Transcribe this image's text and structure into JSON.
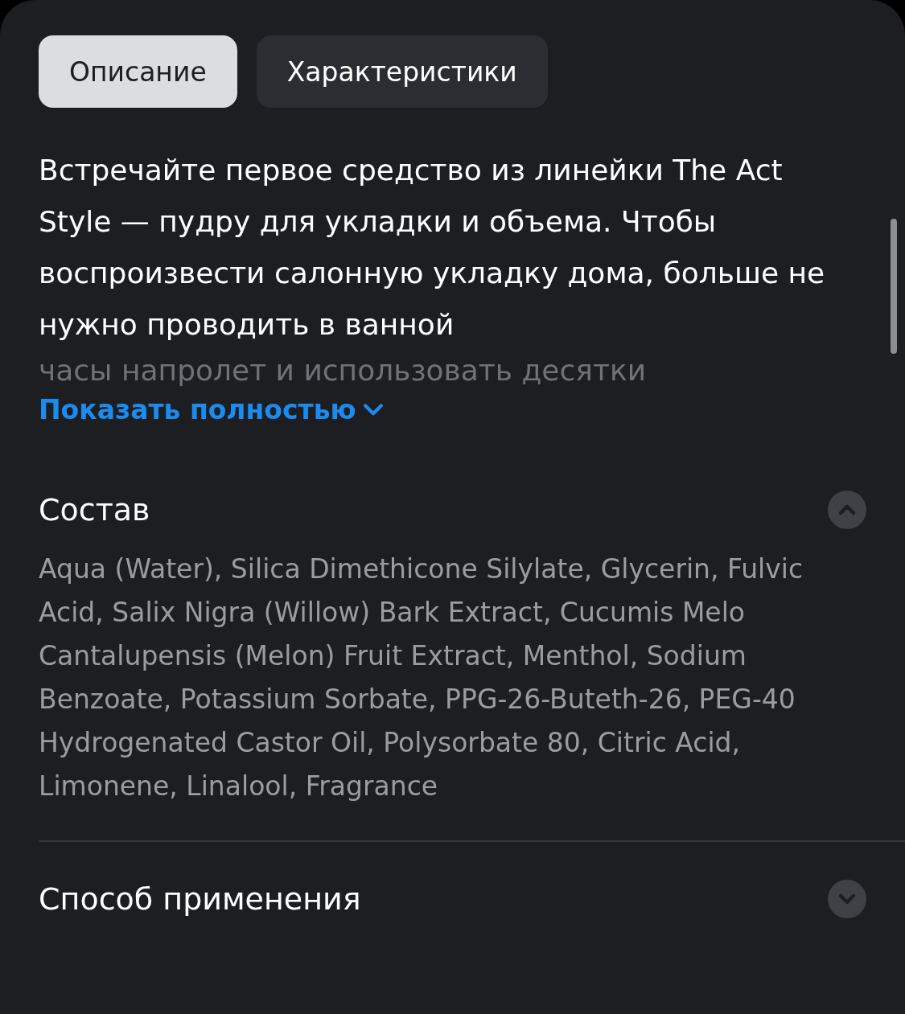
{
  "tabs": [
    {
      "label": "Описание",
      "selected": true
    },
    {
      "label": "Характеристики",
      "selected": false
    }
  ],
  "description": {
    "text": "Встречайте первое средство из линейки The Act Style — пудру для укладки и объема. Чтобы воспроизвести салонную укладку дома, больше не нужно проводить в ванной",
    "faded_text": "часы напролет и использовать десятки",
    "show_more": "Показать полностью"
  },
  "sections": [
    {
      "title": "Состав",
      "expanded": true,
      "text": "Aqua (Water), Silica Dimethicone Silylate, Glycerin, Fulvic Acid, Salix Nigra (Willow) Bark Extract, Cucumis Melo Cantalupensis (Melon) Fruit Extract, Menthol, Sodium Benzoate, Potassium Sorbate, PPG-26-Buteth-26, PEG-40 Hydrogenated Castor Oil, Polysorbate 80, Citric Acid, Limonene, Linalool, Fragrance"
    },
    {
      "title": "Способ применения",
      "expanded": false
    }
  ]
}
